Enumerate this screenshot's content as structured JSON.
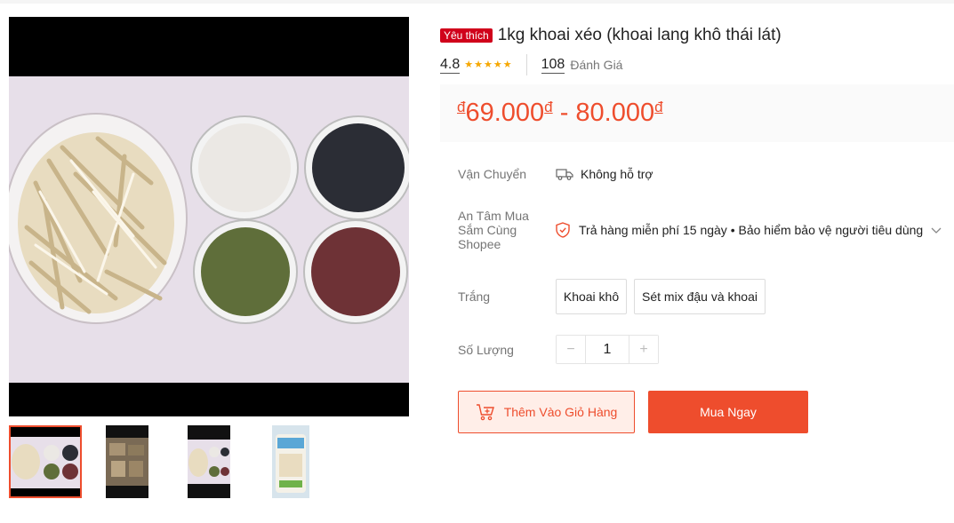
{
  "product": {
    "badge": "Yêu thích",
    "title": "1kg khoai xéo (khoai lang khô thái lát)",
    "rating": "4.8",
    "stars": 4.8,
    "review_count": "108",
    "review_label": "Đánh Giá",
    "price_low": "69.000",
    "price_high": "80.000",
    "currency": "đ",
    "price_separator": " - "
  },
  "shipping": {
    "label": "Vận Chuyển",
    "value": "Không hỗ trợ",
    "icon": "truck-icon"
  },
  "guarantee": {
    "label_lines": [
      "An Tâm Mua",
      "Sắm Cùng",
      "Shopee"
    ],
    "value": "Trả hàng miễn phí 15 ngày • Bảo hiểm bảo vệ người tiêu dùng",
    "icon": "shield-icon"
  },
  "variation": {
    "label": "Trắng",
    "options": [
      "Khoai khô",
      "Sét mix đậu và khoai"
    ]
  },
  "quantity": {
    "label": "Số Lượng",
    "value": "1",
    "minus": "−",
    "plus": "+"
  },
  "actions": {
    "add_to_cart": "Thêm Vào Giỏ Hàng",
    "buy_now": "Mua Ngay"
  },
  "colors": {
    "accent": "#ee4d2d",
    "badge": "#d0011b",
    "star": "#f6a700"
  }
}
